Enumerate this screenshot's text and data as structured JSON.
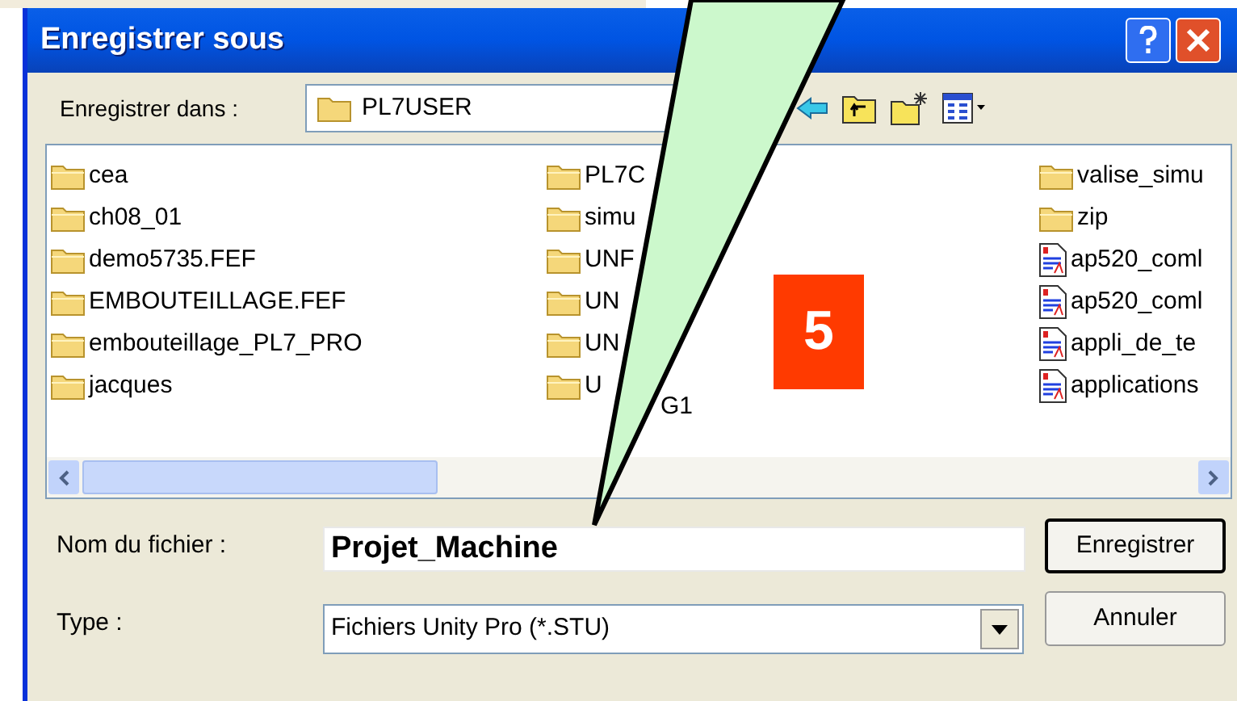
{
  "window": {
    "title": "Enregistrer sous"
  },
  "save_in": {
    "label": "Enregistrer dans :",
    "value": "PL7USER"
  },
  "files": [
    {
      "kind": "folder",
      "name": "cea"
    },
    {
      "kind": "folder",
      "name": "ch08_01"
    },
    {
      "kind": "folder",
      "name": "demo5735.FEF"
    },
    {
      "kind": "folder",
      "name": "EMBOUTEILLAGE.FEF"
    },
    {
      "kind": "folder",
      "name": "embouteillage_PL7_PRO"
    },
    {
      "kind": "folder",
      "name": "jacques"
    },
    {
      "kind": "folder",
      "name": "PL7C"
    },
    {
      "kind": "folder",
      "name": "simu"
    },
    {
      "kind": "folder",
      "name": "UNF"
    },
    {
      "kind": "folder",
      "name": "UN"
    },
    {
      "kind": "folder",
      "name": "UN"
    },
    {
      "kind": "folder",
      "name": "U",
      "tail": "G1"
    },
    {
      "kind": "folder",
      "name": "valise_simu"
    },
    {
      "kind": "folder",
      "name": "zip"
    },
    {
      "kind": "document",
      "name": "ap520_coml"
    },
    {
      "kind": "document",
      "name": "ap520_coml"
    },
    {
      "kind": "document",
      "name": "appli_de_te"
    },
    {
      "kind": "document",
      "name": "applications"
    }
  ],
  "file_name": {
    "label": "Nom du fichier :",
    "value": "Projet_Machine"
  },
  "file_type": {
    "label": "Type :",
    "value": "Fichiers Unity Pro (*.STU)"
  },
  "buttons": [
    "Enregistrer",
    "Annuler"
  ],
  "callout": {
    "number": "5"
  }
}
